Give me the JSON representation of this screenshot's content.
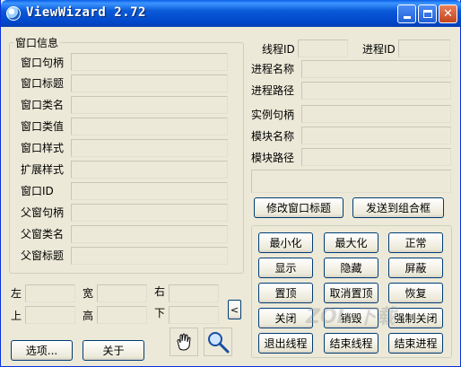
{
  "window": {
    "title": "ViewWizard 2.72"
  },
  "title_buttons": {
    "minimize": "_",
    "maximize": "□",
    "close": "✕"
  },
  "window_info": {
    "legend": "窗口信息",
    "rows": [
      "窗口句柄",
      "窗口标题",
      "窗口类名",
      "窗口类值",
      "窗口样式",
      "扩展样式",
      "窗口ID",
      "父窗句柄",
      "父窗类名",
      "父窗标题"
    ]
  },
  "rect": {
    "left": "左",
    "width": "宽",
    "right": "右",
    "top": "上",
    "height": "高",
    "bottom": "下"
  },
  "collapse_glyph": "<",
  "process_info": {
    "thread_id": "线程ID",
    "process_id": "进程ID",
    "process_name": "进程名称",
    "process_path": "进程路径",
    "instance_handle": "实例句柄",
    "module_name": "模块名称",
    "module_path": "模块路径"
  },
  "actions": {
    "modify_title": "修改窗口标题",
    "send_combo": "发送到组合框",
    "minimize": "最小化",
    "maximize": "最大化",
    "normal": "正常",
    "show": "显示",
    "hide": "隐藏",
    "shield": "屏蔽",
    "topmost": "置顶",
    "untopmost": "取消置顶",
    "restore": "恢复",
    "close": "关闭",
    "destroy": "销毁",
    "force_close": "强制关闭",
    "exit_thread": "退出线程",
    "end_thread": "结束线程",
    "end_process": "结束进程"
  },
  "bottom": {
    "options": "选项...",
    "about": "关于"
  },
  "watermark": "ZOL 下载"
}
